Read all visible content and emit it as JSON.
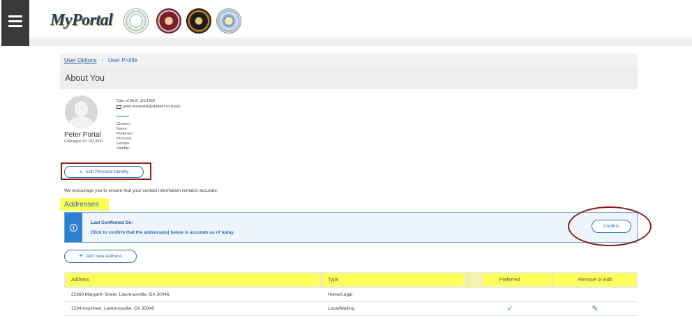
{
  "header": {
    "logo_text": "MyPortal",
    "seals": [
      "college-seal-1",
      "college-seal-2",
      "college-seal-3",
      "college-seal-4"
    ]
  },
  "breadcrumb": {
    "link": "User Options",
    "separator": "›",
    "current": "User Profile"
  },
  "page_title": "About You",
  "profile": {
    "name": "Peter Portal",
    "colleague_id": "Colleague ID: 2613932",
    "dob": "Date of Birth: 1/1/1955",
    "email": "peter.testportal@student.rccd.edu",
    "labels": [
      "Chosen",
      "Name:",
      "Preferred",
      "Pronoun:",
      "Gender",
      "Identity:"
    ]
  },
  "edit_identity_label": "Edit Personal Identity",
  "encourage_text": "We encourage you to ensure that your contact information remains accurate.",
  "addresses_heading": "Addresses",
  "banner": {
    "title": "Last Confirmed On:",
    "text": "Click to confirm that the address(es) below is accurate as of today.",
    "confirm_label": "Confirm"
  },
  "add_address_label": "Add New Address",
  "table": {
    "headers": [
      "Address",
      "Type",
      "Preferred",
      "Remove or Edit"
    ],
    "rows": [
      {
        "address": "22360 Margarth Street, Lawrenceville, GA 30046",
        "type": "Home/Legal",
        "preferred": false
      },
      {
        "address": "1234 Anystreet, Lawrenceville, GA 30046",
        "type": "Local/Mailing",
        "preferred": true
      }
    ]
  },
  "colors": {
    "primary": "#2a6ab5",
    "highlight": "#fbff57",
    "annotation": "#8b1a1a",
    "check": "#2aa37a"
  }
}
